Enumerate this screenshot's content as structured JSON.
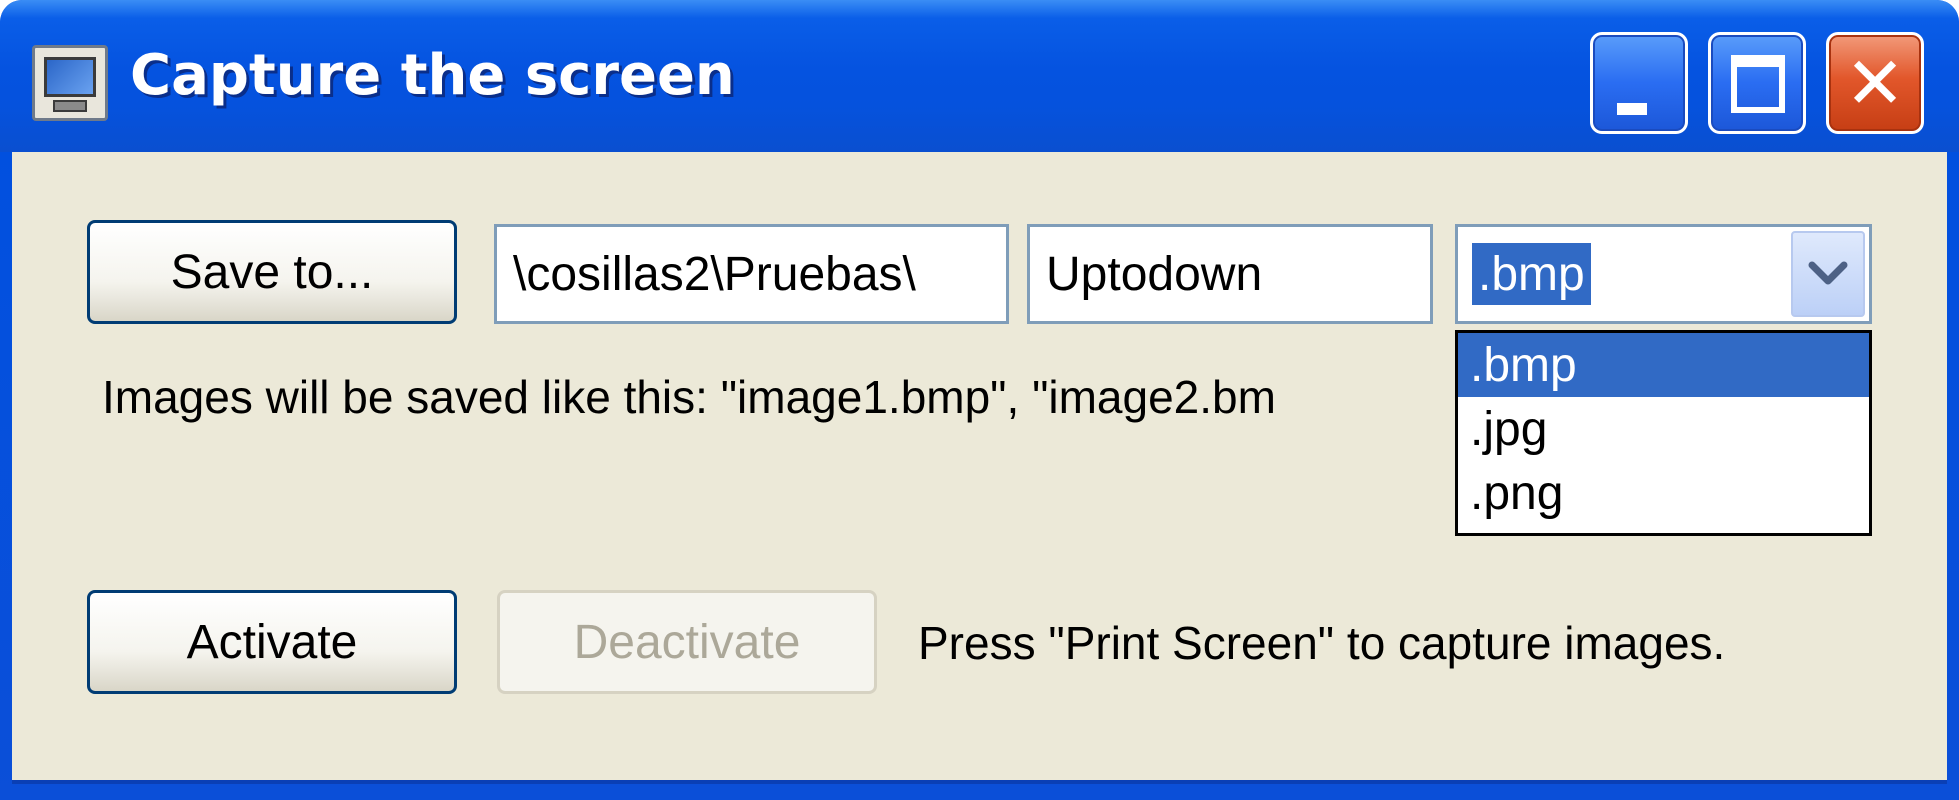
{
  "window": {
    "title": "Capture the screen",
    "icon": "monitor-icon"
  },
  "titlebar_buttons": {
    "minimize": "minimize-icon",
    "maximize": "maximize-icon",
    "close_glyph": "✕"
  },
  "form": {
    "save_to_label": "Save to...",
    "path_value": "\\cosillas2\\Pruebas\\",
    "name_value": "Uptodown",
    "format_selected": ".bmp",
    "format_options": [
      ".bmp",
      ".jpg",
      ".png"
    ],
    "info_text": "Images will be saved like this: \"image1.bmp\", \"image2.bm",
    "activate_label": "Activate",
    "deactivate_label": "Deactivate",
    "hint_text": "Press \"Print Screen\" to capture images."
  },
  "colors": {
    "titlebar": "#0553e0",
    "client_bg": "#ece9d8",
    "selection": "#316ac5",
    "close_button": "#e2572b"
  }
}
